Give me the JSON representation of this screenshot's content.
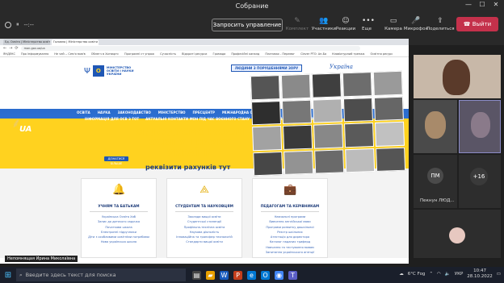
{
  "meeting": {
    "title": "Собрание",
    "timer": "--:--",
    "request_control": "Запросить управление",
    "tools": [
      {
        "label": "Участники",
        "icon": "participants-icon",
        "dim": false
      },
      {
        "label": "Реакции",
        "icon": "reactions-icon",
        "dim": false
      },
      {
        "label": "Еще",
        "icon": "more-icon",
        "dim": false
      },
      {
        "label": "Камера",
        "icon": "camera-icon",
        "dim": false
      },
      {
        "label": "Микрофон",
        "icon": "microphone-icon",
        "dim": false
      },
      {
        "label": "Поделиться",
        "icon": "share-icon",
        "dim": false
      }
    ],
    "dim_tool": "Комплект",
    "leave": "Выйти",
    "presenter_name": "Непомнящая Ирина Миколаївна",
    "leave_color": "#c4314b"
  },
  "browser": {
    "tabs": [
      "Ед. Освіта | Міністерство освіти",
      "Головна | Міністерство освіти"
    ],
    "address": "mon.gov.ua/ua",
    "bookmarks": [
      "ЯНДЕКС",
      "Про інформування",
      "Не чей -- Сем'я мов'в",
      "Облегч в Хогвартс",
      "Програмні ст упраж",
      "Сучасність",
      "Відкриті ресурси",
      "Громада",
      "Професійні каналд",
      "Платовах - Перемог",
      "Clever PTO: Ан-Ба",
      "Клавіатурний тренаж",
      "Освітня ресурс"
    ]
  },
  "site": {
    "logo_text": "МІНІСТЕРСТВО ОСВІТИ І НАУКИ УКРАЇНИ",
    "people_banner": "ЛЮДИНИ З ПОРУШЕННЯМИ ЗОРУ",
    "ukraina": "Україна",
    "menu": [
      "ОСВІТА",
      "НАУКА",
      "ЗАКОНОДАВСТВО",
      "МІНІСТЕРСТВО",
      "ПРЕСЦЕНТР",
      "МІЖНАРОДНА СПІВПРАЦЯ"
    ],
    "menu2": [
      "ІНФОРМАЦІЯ ДЛЯ ОСВ З ТОТ",
      "АКТУАЛЬНІ КОНТАКТИ МОН ПІД ЧАС ВОЄННОГО СТАНУ",
      "ДОСТУП ДО ПУБЛІЧНОЇ ІНФОРМАЦІЇ"
    ],
    "ua_mark": "UA",
    "slogan": "ВІДБУДУЄМО РАЗОМ ОСВІТУ І НАУКУ УКРАЇНИ",
    "more_button": "ДІЗНАТИСЯ БІЛЬШЕ",
    "requisites": "реквізити рахунків тут",
    "cards": [
      {
        "title": "УЧНЯМ ТА БАТЬКАМ",
        "icon": "bell-icon",
        "items": [
          "Українська Освіта Хаб",
          "Запис до дитячого садочка",
          "Початкова школа",
          "Електронні підручники",
          "Діти з особливими освітніми потребами",
          "Нова українська школа"
        ]
      },
      {
        "title": "СТУДЕНТАМ ТА НАУКОВЦЯМ",
        "icon": "compass-icon",
        "items": [
          "Заклади вищої освіти",
          "Студентські стипендії",
          "Профільна-технічна освіта",
          "Наукова діяльність",
          "Інноваційна та трансфер технологій",
          "Стандарти вищої освіти"
        ]
      },
      {
        "title": "ПЕДАГОГАМ ТА КЕРІВНИКАМ",
        "icon": "briefcase-icon",
        "items": [
          "Навчальні програми",
          "Вивчення англійської мови",
          "Програми розвитку дошкільної",
          "Реєстр шкільних",
          "Атестація для директора",
          "Каталог наданих триферд",
          "Навчання та тестування мовам",
          "Запитання українського агенції"
        ]
      }
    ]
  },
  "participants": {
    "initials": "ПМ",
    "name": "Пекнун ЛЮД...",
    "more_count": "+16"
  },
  "taskbar": {
    "search_placeholder": "Введите здесь текст для поиска",
    "weather": "6°C Fog",
    "lang": "УКР",
    "time": "10:47",
    "date": "28.10.2022"
  }
}
